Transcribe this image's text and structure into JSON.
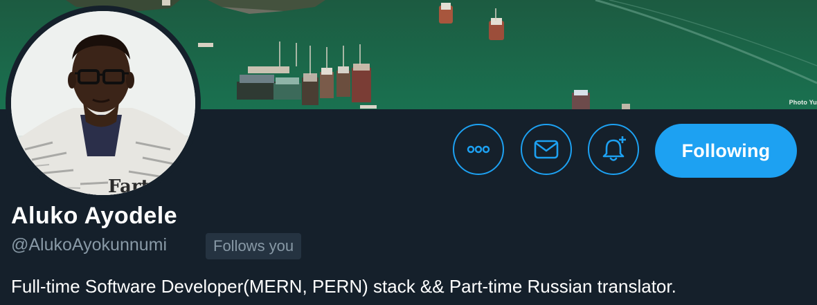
{
  "banner": {
    "photo_credit": "Photo Yu"
  },
  "avatar": {
    "shirt_text": "Fartu"
  },
  "actions": {
    "more_icon": "more-horizontal-icon",
    "message_icon": "envelope-icon",
    "notify_icon": "bell-plus-icon",
    "following_label": "Following"
  },
  "profile": {
    "display_name": "Aluko Ayodele",
    "handle": "@AlukoAyokunnumi",
    "follows_badge": "Follows you",
    "bio": "Full-time Software Developer(MERN, PERN) stack && Part-time Russian translator."
  },
  "colors": {
    "background": "#15202b",
    "accent": "#1da1f2",
    "secondary_text": "#8899a6",
    "badge_bg": "#253341"
  }
}
